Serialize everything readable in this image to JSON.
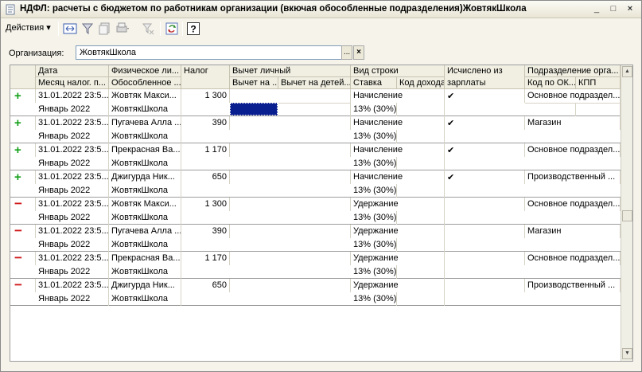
{
  "window": {
    "title": "НДФЛ: расчеты с бюджетом по работникам организации (вкючая обособленные подразделения)ЖовтякШкола",
    "minimize_glyph": "_",
    "maximize_glyph": "□",
    "close_glyph": "×"
  },
  "toolbar": {
    "actions_label": "Действия",
    "actions_arrow": "▾"
  },
  "org": {
    "label": "Организация:",
    "value": "ЖовтякШкола",
    "select_glyph": "...",
    "clear_glyph": "×"
  },
  "columns": {
    "date": "Дата",
    "period": "Месяц налог. п...",
    "person": "Физическое ли...",
    "subdivision_sep": "Обособленное ...",
    "tax": "Налог",
    "deduction": "Вычет личный",
    "deduction_on": "Вычет на ...",
    "deduction_children": "Вычет на детей...",
    "row_kind": "Вид строки",
    "rate": "Ставка",
    "income_code": "Код дохода",
    "calc_from_salary": "Исчислено из зарплаты",
    "org_unit": "Подразделение орга...",
    "okato": "Код по ОК...",
    "kpp": "КПП"
  },
  "rows": [
    {
      "sign": "+",
      "date": "31.01.2022 23:5...",
      "person": "Жовтяк Макси...",
      "tax": "1 300",
      "kind": "Начисление",
      "period": "Январь 2022",
      "sub": "ЖовтякШкола",
      "rate": "13% (30%)",
      "check": "✔",
      "unit": "Основное подраздел..."
    },
    {
      "sign": "+",
      "date": "31.01.2022 23:5...",
      "person": "Пугачева Алла ...",
      "tax": "390",
      "kind": "Начисление",
      "period": "Январь 2022",
      "sub": "ЖовтякШкола",
      "rate": "13% (30%)",
      "check": "✔",
      "unit": "Магазин"
    },
    {
      "sign": "+",
      "date": "31.01.2022 23:5...",
      "person": "Прекрасная Ва...",
      "tax": "1 170",
      "kind": "Начисление",
      "period": "Январь 2022",
      "sub": "ЖовтякШкола",
      "rate": "13% (30%)",
      "check": "✔",
      "unit": "Основное подраздел..."
    },
    {
      "sign": "+",
      "date": "31.01.2022 23:5...",
      "person": "Джигурда Ник...",
      "tax": "650",
      "kind": "Начисление",
      "period": "Январь 2022",
      "sub": "ЖовтякШкола",
      "rate": "13% (30%)",
      "check": "✔",
      "unit": "Производственный ..."
    },
    {
      "sign": "−",
      "date": "31.01.2022 23:5...",
      "person": "Жовтяк Макси...",
      "tax": "1 300",
      "kind": "Удержание",
      "period": "Январь 2022",
      "sub": "ЖовтякШкола",
      "rate": "13% (30%)",
      "check": "",
      "unit": "Основное подраздел..."
    },
    {
      "sign": "−",
      "date": "31.01.2022 23:5...",
      "person": "Пугачева Алла ...",
      "tax": "390",
      "kind": "Удержание",
      "period": "Январь 2022",
      "sub": "ЖовтякШкола",
      "rate": "13% (30%)",
      "check": "",
      "unit": "Магазин"
    },
    {
      "sign": "−",
      "date": "31.01.2022 23:5...",
      "person": "Прекрасная Ва...",
      "tax": "1 170",
      "kind": "Удержание",
      "period": "Январь 2022",
      "sub": "ЖовтякШкола",
      "rate": "13% (30%)",
      "check": "",
      "unit": "Основное подраздел..."
    },
    {
      "sign": "−",
      "date": "31.01.2022 23:5...",
      "person": "Джигурда Ник...",
      "tax": "650",
      "kind": "Удержание",
      "period": "Январь 2022",
      "sub": "ЖовтякШкола",
      "rate": "13% (30%)",
      "check": "",
      "unit": "Производственный ..."
    }
  ],
  "colors": {
    "plus": "#15a01a",
    "minus": "#d0181a",
    "selection": "#0a1f8f"
  },
  "scrollbar": {
    "up_glyph": "▲",
    "down_glyph": "▼"
  }
}
